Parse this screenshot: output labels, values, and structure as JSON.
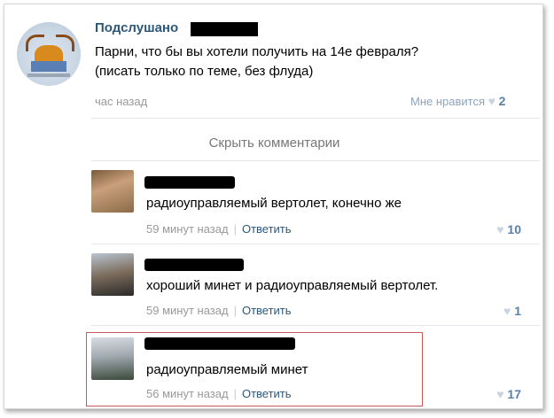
{
  "post": {
    "author": "Подслушано",
    "text": "Парни, что бы вы хотели получить на 14е февраля? (писать только по теме, без флуда)",
    "time": "час назад",
    "like_label": "Мне нравится",
    "like_count": "2"
  },
  "hide_comments": "Скрыть комментарии",
  "comments": [
    {
      "text": "радиоуправляемый вертолет, конечно же",
      "time": "59 минут назад",
      "separator": "|",
      "reply": "Ответить",
      "likes": "10"
    },
    {
      "text": "хороший минет и радиоуправляемый вертолет.",
      "time": "59 минут назад",
      "separator": "|",
      "reply": "Ответить",
      "likes": "1"
    },
    {
      "text": "радиоуправляемый минет",
      "time": "56 минут назад",
      "separator": "|",
      "reply": "Ответить",
      "likes": "17"
    }
  ],
  "icons": {
    "heart": "heart-icon"
  },
  "colors": {
    "link": "#2b587a",
    "muted": "#999999",
    "like": "#5a7fa8",
    "highlight": "#c55a5a"
  }
}
